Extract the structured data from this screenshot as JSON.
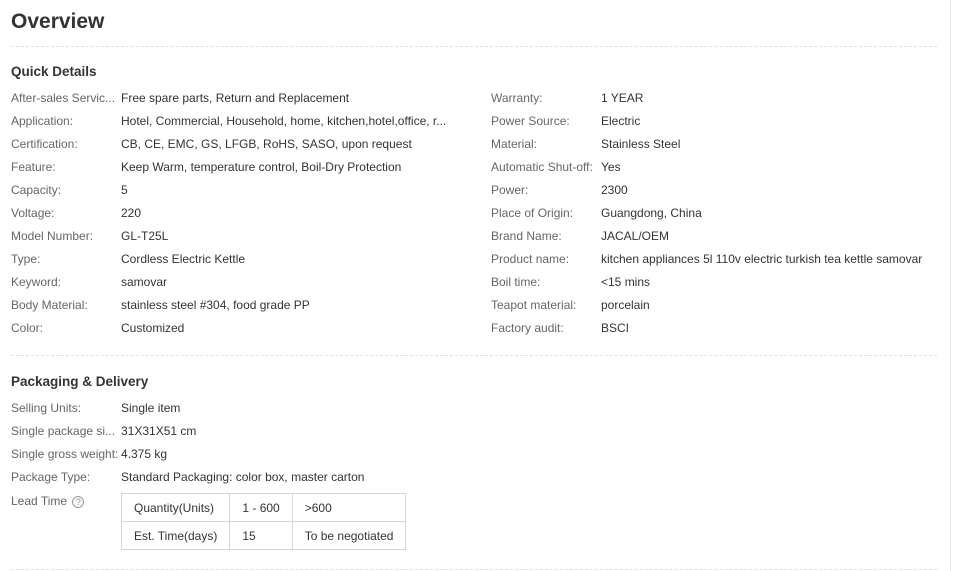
{
  "title": "Overview",
  "quick_details": {
    "heading": "Quick Details",
    "left": [
      {
        "label": "After-sales Servic...",
        "value": "Free spare parts, Return and Replacement"
      },
      {
        "label": "Application:",
        "value": "Hotel, Commercial, Household, home, kitchen,hotel,office, r..."
      },
      {
        "label": "Certification:",
        "value": "CB, CE, EMC, GS, LFGB, RoHS, SASO, upon request"
      },
      {
        "label": "Feature:",
        "value": "Keep Warm, temperature control, Boil-Dry Protection"
      },
      {
        "label": "Capacity:",
        "value": "5"
      },
      {
        "label": "Voltage:",
        "value": "220"
      },
      {
        "label": "Model Number:",
        "value": "GL-T25L"
      },
      {
        "label": "Type:",
        "value": "Cordless Electric Kettle"
      },
      {
        "label": "Keyword:",
        "value": "samovar"
      },
      {
        "label": "Body Material:",
        "value": "stainless steel #304, food grade PP"
      },
      {
        "label": "Color:",
        "value": "Customized"
      }
    ],
    "right": [
      {
        "label": "Warranty:",
        "value": "1 YEAR"
      },
      {
        "label": "Power Source:",
        "value": "Electric"
      },
      {
        "label": "Material:",
        "value": "Stainless Steel"
      },
      {
        "label": "Automatic Shut-off:",
        "value": "Yes"
      },
      {
        "label": "Power:",
        "value": "2300"
      },
      {
        "label": "Place of Origin:",
        "value": "Guangdong, China"
      },
      {
        "label": "Brand Name:",
        "value": "JACAL/OEM"
      },
      {
        "label": "Product name:",
        "value": "kitchen appliances 5l 110v electric turkish tea kettle samovar"
      },
      {
        "label": "Boil time:",
        "value": "<15 mins"
      },
      {
        "label": "Teapot material:",
        "value": "porcelain"
      },
      {
        "label": "Factory audit:",
        "value": "BSCI"
      }
    ]
  },
  "packaging": {
    "heading": "Packaging & Delivery",
    "rows": [
      {
        "label": "Selling Units:",
        "value": "Single item"
      },
      {
        "label": "Single package si...",
        "value": "31X31X51 cm"
      },
      {
        "label": "Single gross weight:",
        "value": "4.375 kg"
      },
      {
        "label": "Package Type:",
        "value": "Standard Packaging: color box, master carton"
      }
    ],
    "lead_time_label": "Lead Time",
    "help_icon": "?",
    "lead_table": [
      [
        "Quantity(Units)",
        "1 - 600",
        ">600"
      ],
      [
        "Est. Time(days)",
        "15",
        "To be negotiated"
      ]
    ]
  }
}
